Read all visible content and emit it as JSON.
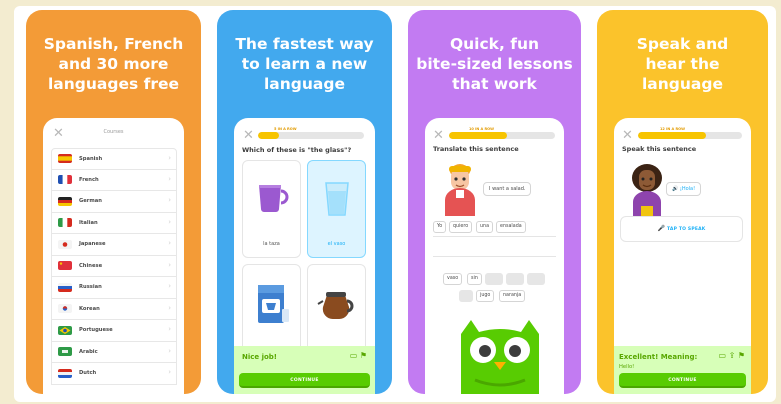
{
  "cards": [
    {
      "headline": "Spanish, French\nand 30 more\nlanguages free",
      "color": "#f39b37"
    },
    {
      "headline": "The fastest way\nto learn a new\nlanguage",
      "color": "#42a9ee"
    },
    {
      "headline": "Quick, fun\nbite-sized lessons\nthat work",
      "color": "#c27bf2"
    },
    {
      "headline": "Speak and\nhear the\nlanguage",
      "color": "#fbc32b"
    }
  ],
  "courses_screen": {
    "title": "Courses",
    "languages": [
      {
        "name": "Spanish",
        "flag": "spain-flag-icon"
      },
      {
        "name": "French",
        "flag": "france-flag-icon"
      },
      {
        "name": "German",
        "flag": "germany-flag-icon"
      },
      {
        "name": "Italian",
        "flag": "italy-flag-icon"
      },
      {
        "name": "Japanese",
        "flag": "japan-flag-icon"
      },
      {
        "name": "Chinese",
        "flag": "china-flag-icon"
      },
      {
        "name": "Russian",
        "flag": "russia-flag-icon"
      },
      {
        "name": "Korean",
        "flag": "korea-flag-icon"
      },
      {
        "name": "Portuguese",
        "flag": "brazil-flag-icon"
      },
      {
        "name": "Arabic",
        "flag": "arabic-flag-icon"
      },
      {
        "name": "Dutch",
        "flag": "netherlands-flag-icon"
      }
    ]
  },
  "quiz_screen": {
    "progress_label": "5 IN A ROW",
    "progress": 0.2,
    "prompt": "Which of these is \"the glass\"?",
    "choices": [
      {
        "label": "la taza",
        "selected": false
      },
      {
        "label": "el vaso",
        "selected": true
      },
      {
        "label": "",
        "selected": false
      },
      {
        "label": "",
        "selected": false
      }
    ],
    "feedback_title": "Nice job!",
    "continue_label": "CONTINUE"
  },
  "translate_screen": {
    "progress_label": "10 IN A ROW",
    "progress": 0.55,
    "prompt": "Translate this sentence",
    "sentence": "I want a salad.",
    "answer_words": [
      "Yo",
      "quiero",
      "una",
      "ensalada"
    ],
    "bank_row1": [
      "vaso",
      "sin",
      "",
      "",
      ""
    ],
    "bank_row2": [
      "",
      "jugo",
      "naranja"
    ]
  },
  "speak_screen": {
    "progress_label": "12 IN A ROW",
    "progress": 0.65,
    "prompt": "Speak this sentence",
    "phrase": "¡Hola!",
    "tap_label": "TAP TO SPEAK",
    "feedback_title": "Excellent! Meaning:",
    "feedback_text": "Hello!",
    "continue_label": "CONTINUE"
  }
}
